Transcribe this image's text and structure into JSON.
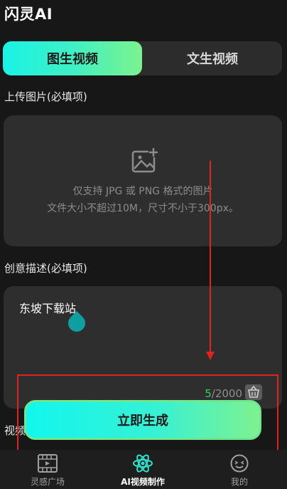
{
  "app": {
    "title": "闪灵AI"
  },
  "tabs": [
    {
      "label": "图生视频",
      "active": true
    },
    {
      "label": "文生视频",
      "active": false
    }
  ],
  "upload": {
    "label": "上传图片(必填项)",
    "hint_line1": "仅支持 JPG 或 PNG 格式的图片",
    "hint_line2": "文件大小不超过10M，尺寸不小于300px。",
    "icon": "add-image-icon"
  },
  "description": {
    "label": "创意描述(必填项)",
    "value": "东坡下载站",
    "count": "5",
    "max": "/2000",
    "clear_icon": "clear-icon"
  },
  "hidden_section": {
    "label": "视频"
  },
  "generate": {
    "label": "立即生成"
  },
  "nav": [
    {
      "label": "灵感广场",
      "icon": "film-icon",
      "active": false
    },
    {
      "label": "AI视频制作",
      "icon": "atom-icon",
      "active": true
    },
    {
      "label": "我的",
      "icon": "smiley-icon",
      "active": false
    }
  ],
  "colors": {
    "background": "#171717",
    "accent_start": "#19f3e5",
    "accent_end": "#7cf28e",
    "annotation_red": "#e0231f"
  }
}
